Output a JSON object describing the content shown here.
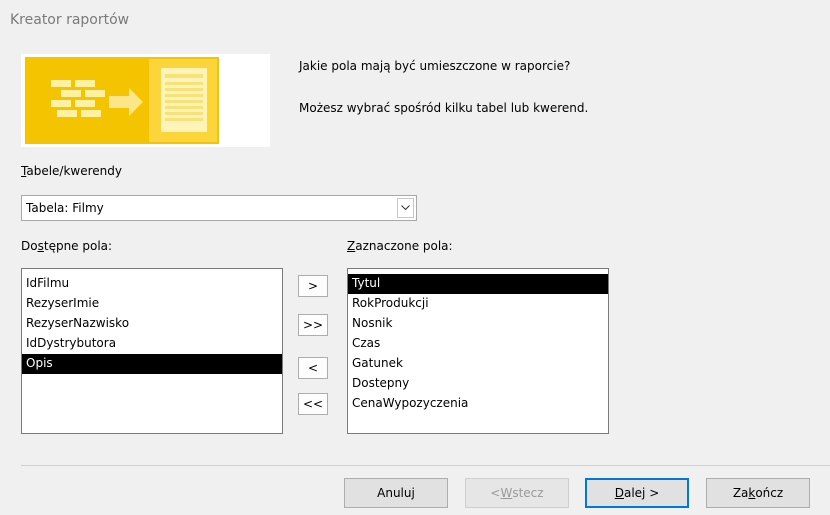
{
  "window": {
    "title": "Kreator raportów"
  },
  "header": {
    "question": "Jakie pola mają być umieszczone w raporcie?",
    "hint": "Możesz wybrać spośród kilku tabel lub kwerend.",
    "image_icon": "report-wizard-illustration"
  },
  "tables": {
    "label": "Tabele/kwerendy",
    "label_rest": "abele/kwerendy",
    "label_key": "T",
    "selected": "Tabela: Filmy"
  },
  "available": {
    "label_pre": "Do",
    "label_key": "s",
    "label_post": "tępne pola:",
    "items": [
      "IdFilmu",
      "RezyserImie",
      "RezyserNazwisko",
      "IdDystrybutora",
      "Opis"
    ],
    "selected_item": "Opis"
  },
  "selected_fields": {
    "label_key": "Z",
    "label_rest": "aznaczone pola:",
    "items": [
      "Tytul",
      "RokProdukcji",
      "Nosnik",
      "Czas",
      "Gatunek",
      "Dostepny",
      "CenaWypozyczenia"
    ],
    "selected_item": "Tytul"
  },
  "move_buttons": {
    "add_one": ">",
    "add_all": ">>",
    "remove_one": "<",
    "remove_all": "<<"
  },
  "footer": {
    "cancel": "Anuluj",
    "back_pre": "< ",
    "back_key": "W",
    "back_post": "stecz",
    "next_key": "D",
    "next_post": "alej >",
    "finish_pre": "Za",
    "finish_key": "k",
    "finish_post": "ończ"
  },
  "colors": {
    "accent_border": "#0078d7",
    "selection_bg": "#000000",
    "illustration": "#f5c400"
  }
}
